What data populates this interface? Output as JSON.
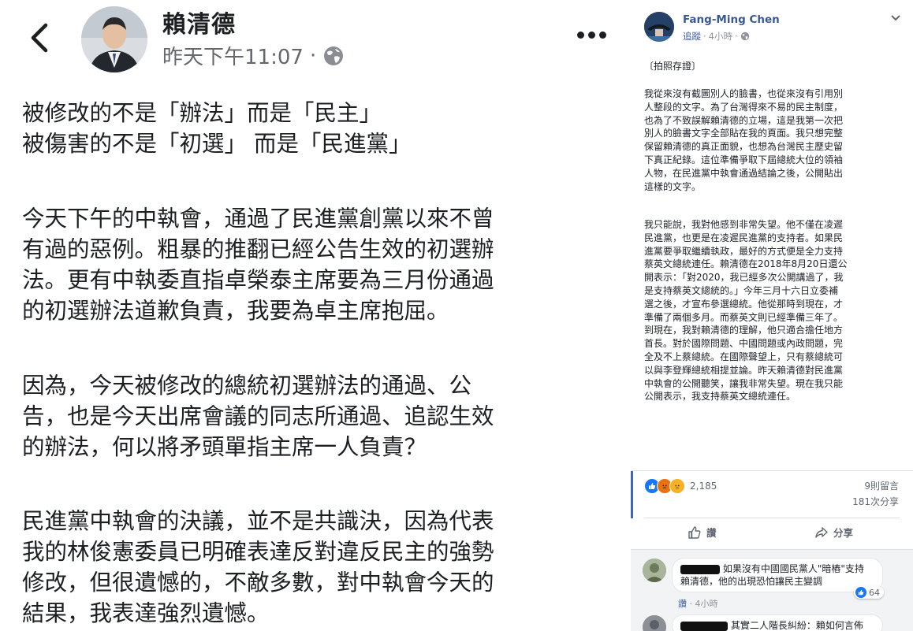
{
  "mobile_post": {
    "author": "賴清德",
    "timestamp": "昨天下午11:07",
    "dot": "·",
    "icons": {
      "back": "back-arrow-icon",
      "privacy": "globe-icon",
      "more": "more-options-icon"
    },
    "headline": [
      "被修改的不是「辦法」而是「民主」",
      "被傷害的不是「初選」 而是「民進黨」"
    ],
    "paragraphs": [
      [
        "今天下午的中執會，通過了民進黨創黨以來不曾",
        "有過的惡例。粗暴的推翻已經公告生效的初選辦",
        "法。更有中執委直指卓榮泰主席要為三月份通過",
        "的初選辦法道歉負責，我要為卓主席抱屈。"
      ],
      [
        "因為，今天被修改的總統初選辦法的通過、公",
        "告，也是今天出席會議的同志所通過、追認生效",
        "的辦法，何以將矛頭單指主席一人負責？"
      ],
      [
        "民進黨中執會的決議，並不是共識決，因為代表",
        "我的林俊憲委員已明確表達反對違反民主的強勢",
        "修改，但很遺憾的，不敵多數，對中執會今天的",
        "結果，我表達強烈遺憾。"
      ]
    ]
  },
  "desktop_post": {
    "author": "Fang-Ming Chen",
    "follow": "追蹤",
    "time": "4小時",
    "sep": "·",
    "tag": "〔拍照存證〕",
    "paragraph1": [
      "我從來沒有截圖別人的臉書，也從來沒有引用別",
      "人整段的文字。為了台灣得來不易的民主制度，",
      "也為了不致誤解賴清德的立場，這是我第一次把",
      "別人的臉書文字全部貼在我的頁面。我只想完整",
      "保留賴清德的真正面貌，也想為台灣民主歷史留",
      "下真正紀錄。這位準備爭取下屆總統大位的領袖",
      "人物，在民進黨中執會通過結論之後，公開貼出",
      "這樣的文字。"
    ],
    "paragraph2": [
      "我只能說，我對他感到非常失望。他不僅在凌遲",
      "民進黨，也更是在凌遲民進黨的支持者。如果民",
      "進黨要爭取繼續執政，最好的方式便是全力支持",
      "蔡英文總統連任。賴清德在2018年8月20日還公",
      "開表示：「對2020，我已經多次公開講過了，我",
      "是支持蔡英文總統的。」今年三月十六日立委補",
      "選之後，才宣布參選總統。他從那時到現在，才",
      "準備了兩個多月。而蔡英文則已經準備三年了。",
      "到現在，我對賴清德的理解，他只適合擔任地方",
      "首長。對於國際問題、中國問題或內政問題，完",
      "全及不上蔡總統。在國際聲望上，只有蔡總統可",
      "以與李登輝總統相提並論。昨天賴清德對民進黨",
      "中執會的公開聽笑，讓我非常失望。現在我只能",
      "公開表示，我支持蔡英文總統連任。"
    ],
    "reactions": {
      "count": "2,185",
      "types": [
        "like",
        "angry",
        "sad"
      ],
      "colors": [
        "#1877f2",
        "#e9710f",
        "#f7b125"
      ]
    },
    "comments_count": "9則留言",
    "shares_count": "181次分享",
    "actions": {
      "like": "讚",
      "share": "分享"
    },
    "comments": [
      {
        "text": "如果沒有中國國民黨人\"暗樁\"支持賴清德，他的出現恐怕讓民主變調",
        "line1": "如果沒有中國國民黨人\"暗樁\"支持",
        "line2": "賴清德，他的出現恐怕讓民主變調",
        "likes": "64",
        "like_label": "讚",
        "time": "4小時"
      },
      {
        "text": "其實二人階長糾紛：賴如何言佈",
        "likes": "",
        "time": ""
      }
    ]
  }
}
